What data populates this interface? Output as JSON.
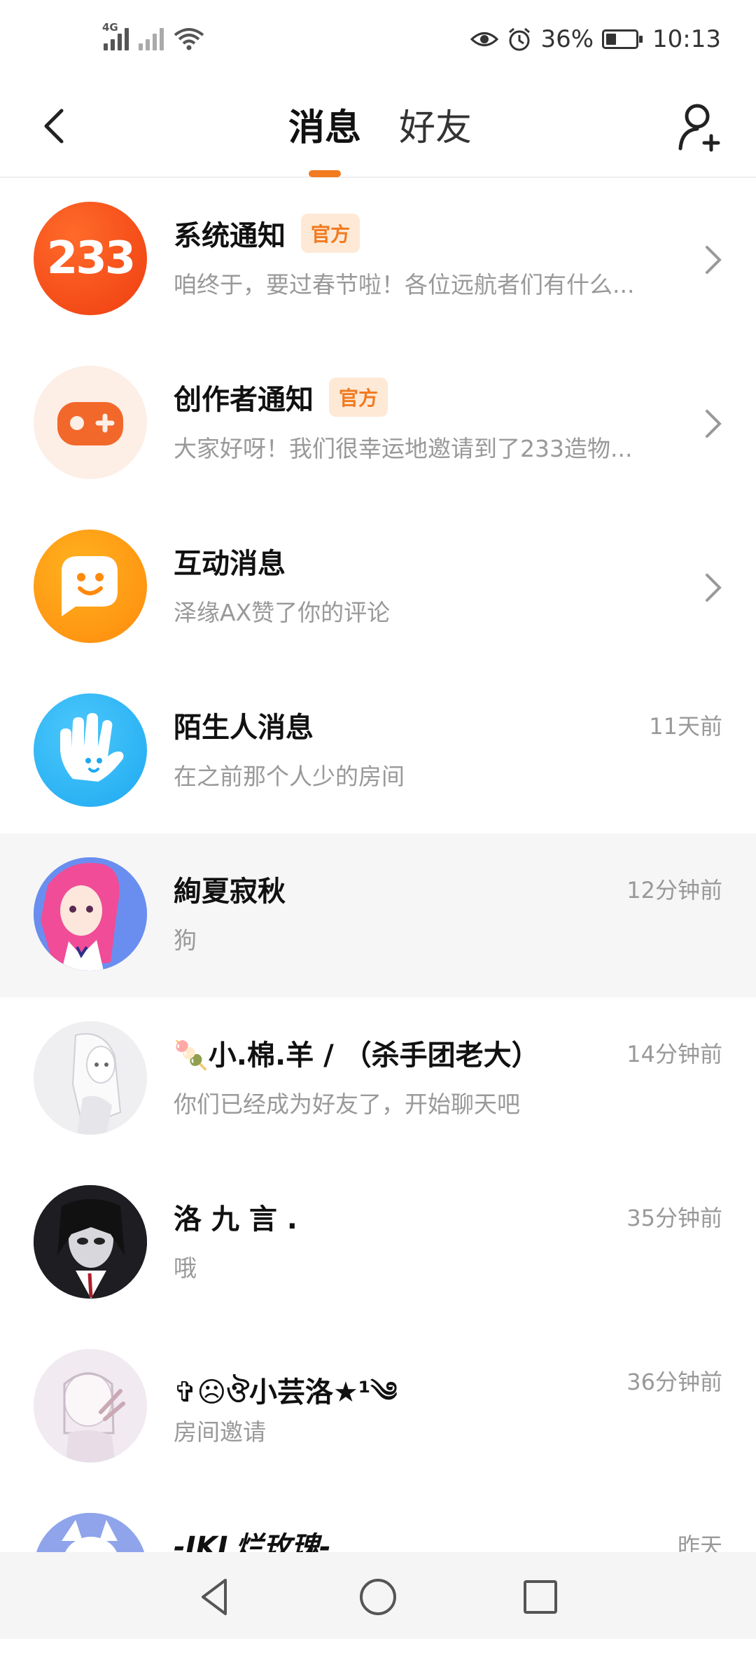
{
  "status_bar": {
    "network": "4G",
    "battery_percent": "36%",
    "battery_level": 0.36,
    "time": "10:13"
  },
  "header": {
    "tabs": [
      {
        "label": "消息",
        "active": true
      },
      {
        "label": "好友",
        "active": false
      }
    ]
  },
  "colors": {
    "accent": "#f27a1f",
    "badge_bg": "#fde9d6"
  },
  "conversations": [
    {
      "name": "系统通知",
      "badge": "官方",
      "preview": "咱终于，要过春节啦！各位远航者们有什么...",
      "avatar_icon": "233-logo-icon",
      "avatar_text": "233"
    },
    {
      "name": "创作者通知",
      "badge": "官方",
      "preview": "大家好呀！我们很幸运地邀请到了233造物...",
      "avatar_icon": "gamepad-icon"
    },
    {
      "name": "互动消息",
      "preview": "泽缘AX赞了你的评论",
      "avatar_icon": "chat-face-icon"
    },
    {
      "name": "陌生人消息",
      "preview": "在之前那个人少的房间",
      "time": "11天前",
      "avatar_icon": "hand-wave-icon"
    },
    {
      "name": "絢夏寂秋",
      "preview": "狗",
      "time": "12分钟前",
      "avatar_icon": "user-avatar"
    },
    {
      "name": "🍡小.棉.羊 / （杀手团老大）",
      "preview": "你们已经成为好友了，开始聊天吧",
      "time": "14分钟前",
      "avatar_icon": "user-avatar"
    },
    {
      "name": "洛 九 言 .",
      "preview": "哦",
      "time": "35分钟前",
      "avatar_icon": "user-avatar"
    },
    {
      "name": "✞☹ঔ小芸洛★¹༄",
      "preview": "房间邀请",
      "time": "36分钟前",
      "avatar_icon": "user-avatar"
    },
    {
      "name": "-IKL烂玫瑰-",
      "preview": "",
      "time": "昨天",
      "avatar_icon": "user-avatar"
    }
  ]
}
